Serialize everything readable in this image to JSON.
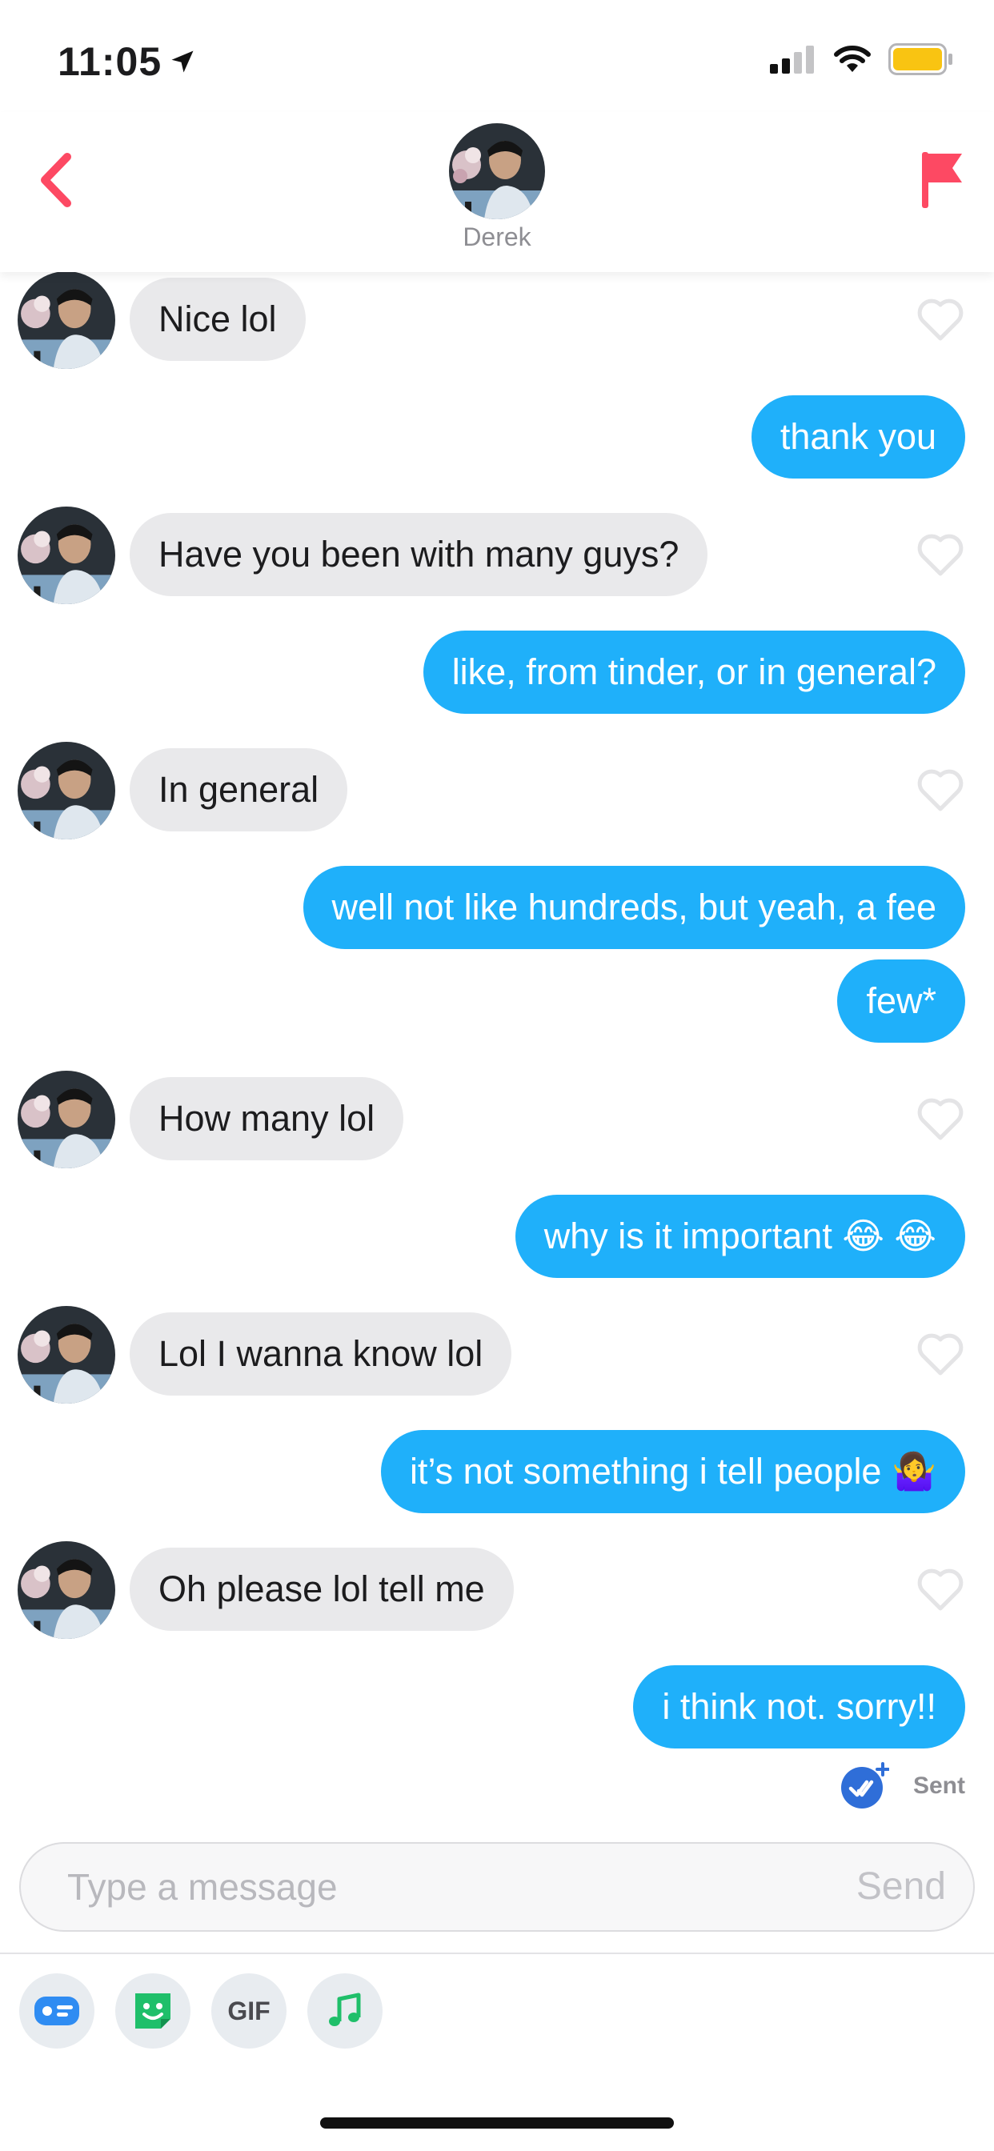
{
  "status": {
    "time": "11:05"
  },
  "header": {
    "contact_name": "Derek"
  },
  "messages": [
    {
      "from": "them",
      "text": "Nice lol"
    },
    {
      "from": "me",
      "text": "thank you"
    },
    {
      "from": "them",
      "text": "Have you been with many guys?"
    },
    {
      "from": "me",
      "text": "like, from tinder, or in general?"
    },
    {
      "from": "them",
      "text": "In general"
    },
    {
      "from": "me",
      "text": "well not like hundreds, but yeah, a fee"
    },
    {
      "from": "me",
      "text": "few*"
    },
    {
      "from": "them",
      "text": "How many lol"
    },
    {
      "from": "me",
      "text": "why is it important 😂 😂"
    },
    {
      "from": "them",
      "text": "Lol I wanna know lol"
    },
    {
      "from": "me",
      "text": "it’s not something i tell people 🤷‍♀️"
    },
    {
      "from": "them",
      "text": "Oh please lol tell me"
    },
    {
      "from": "me",
      "text": "i think not. sorry!!"
    }
  ],
  "receipt": {
    "label": "Sent"
  },
  "composer": {
    "placeholder": "Type a message",
    "send_label": "Send"
  },
  "toolbar": {
    "gif_label": "GIF"
  },
  "colors": {
    "accent": "#fd4963",
    "outgoing_bubble": "#1fb0fa",
    "incoming_bubble": "#e9e9eb"
  }
}
